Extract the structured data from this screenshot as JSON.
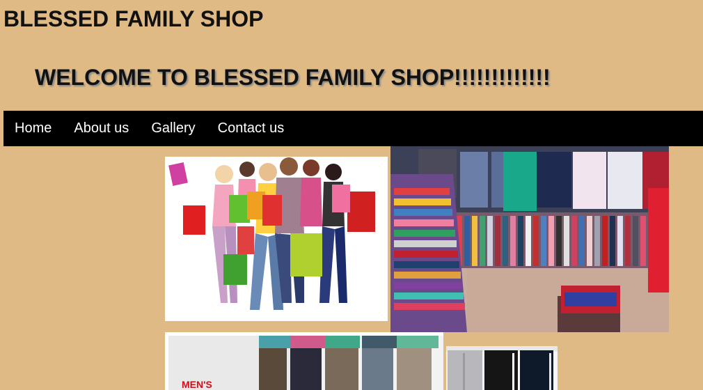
{
  "header": {
    "site_title": "BLESSED FAMILY SHOP",
    "welcome": "WELCOME TO BLESSED FAMILY SHOP!!!!!!!!!!!!!"
  },
  "nav": {
    "items": [
      {
        "label": "Home"
      },
      {
        "label": "About us"
      },
      {
        "label": "Gallery"
      },
      {
        "label": "Contact us"
      }
    ]
  },
  "gallery": {
    "images": [
      {
        "name": "shoppers-photo",
        "icon": "shopping-people-image"
      },
      {
        "name": "clothing-store-photo",
        "icon": "clothing-store-image"
      },
      {
        "name": "mens-banner-photo",
        "icon": "mens-clothing-image",
        "caption": "MEN'S"
      },
      {
        "name": "pants-photo",
        "icon": "pants-image"
      }
    ]
  },
  "colors": {
    "background": "#dfba85",
    "nav_background": "#000000",
    "nav_text": "#ffffff"
  }
}
